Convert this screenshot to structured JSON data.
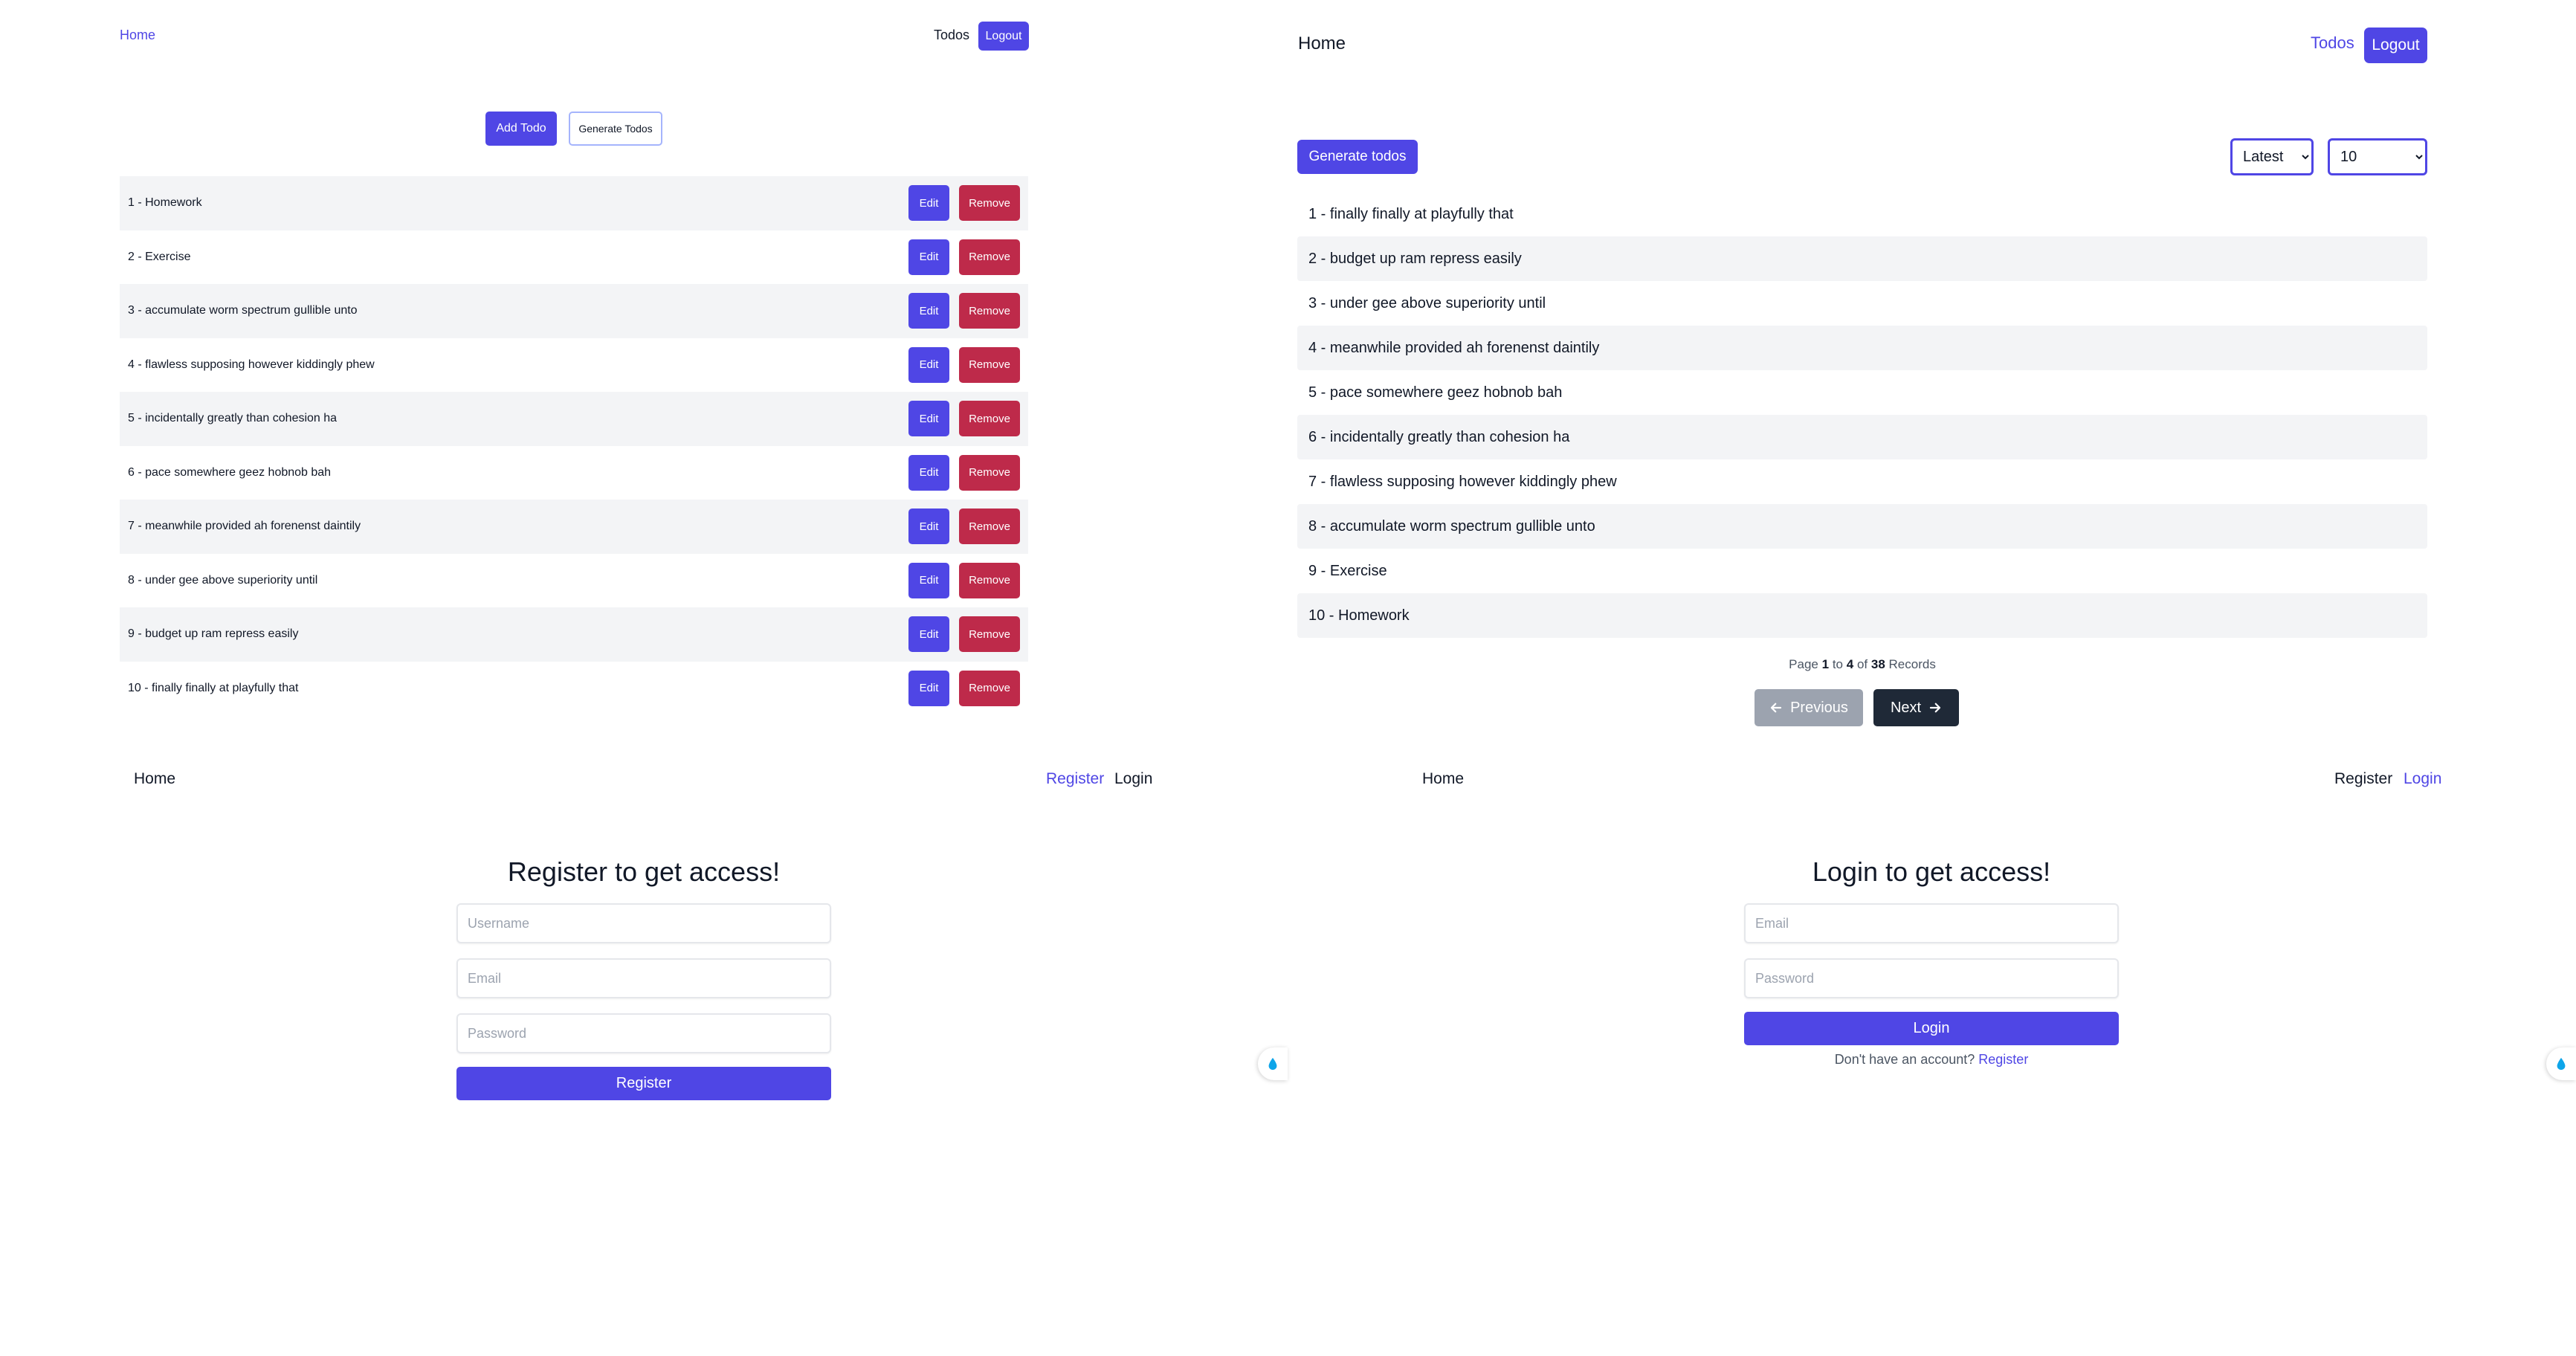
{
  "todo_manage": {
    "nav": {
      "home": "Home",
      "todos": "Todos",
      "logout": "Logout"
    },
    "actions": {
      "add": "Add Todo",
      "generate": "Generate Todos"
    },
    "row_actions": {
      "edit": "Edit",
      "remove": "Remove"
    },
    "items": [
      "1 - Homework",
      "2 - Exercise",
      "3 - accumulate worm spectrum gullible unto",
      "4 - flawless supposing however kiddingly phew",
      "5 - incidentally greatly than cohesion ha",
      "6 - pace somewhere geez hobnob bah",
      "7 - meanwhile provided ah forenenst daintily",
      "8 - under gee above superiority until",
      "9 - budget up ram repress easily",
      "10 - finally finally at playfully that"
    ]
  },
  "todo_paged": {
    "nav": {
      "home": "Home",
      "todos": "Todos",
      "logout": "Logout"
    },
    "generate": "Generate todos",
    "sort": {
      "selected": "Latest"
    },
    "page_size": {
      "selected": "10"
    },
    "items": [
      "1 - finally finally at playfully that",
      "2 - budget up ram repress easily",
      "3 - under gee above superiority until",
      "4 - meanwhile provided ah forenenst daintily",
      "5 - pace somewhere geez hobnob bah",
      "6 - incidentally greatly than cohesion ha",
      "7 - flawless supposing however kiddingly phew",
      "8 - accumulate worm spectrum gullible unto",
      "9 - Exercise",
      "10 - Homework"
    ],
    "pagination": {
      "page_label": "Page",
      "page": "1",
      "to_label": "to",
      "total_pages": "4",
      "of_label": "of",
      "records": "38",
      "records_label": "Records",
      "previous": "Previous",
      "next": "Next"
    }
  },
  "register_page": {
    "nav": {
      "home": "Home",
      "register": "Register",
      "login": "Login"
    },
    "heading": "Register to get access!",
    "fields": {
      "username": "Username",
      "email": "Email",
      "password": "Password"
    },
    "submit": "Register"
  },
  "login_page": {
    "nav": {
      "home": "Home",
      "register": "Register",
      "login": "Login"
    },
    "heading": "Login to get access!",
    "fields": {
      "email": "Email",
      "password": "Password"
    },
    "submit": "Login",
    "footer_text": "Don't have an account?",
    "footer_link": "Register"
  },
  "colors": {
    "primary": "#4f46e5",
    "danger": "#be2a4a",
    "muted_button": "#9ca3af",
    "dark_button": "#1f2937",
    "row_alt": "#f3f4f6"
  },
  "icons": {
    "previous": "arrow-left-icon",
    "next": "arrow-right-icon",
    "widget": "droplet-icon"
  }
}
